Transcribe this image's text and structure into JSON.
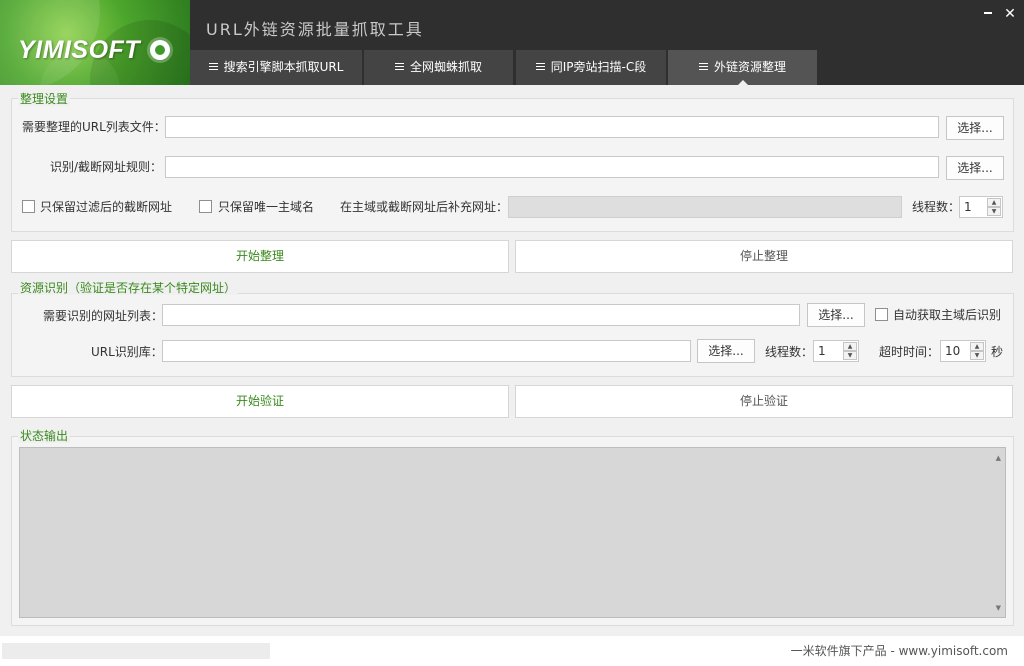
{
  "app": {
    "logo_text": "YIMISOFT",
    "title": "URL外链资源批量抓取工具"
  },
  "tabs": [
    {
      "label": "搜索引擎脚本抓取URL",
      "active": false
    },
    {
      "label": "全网蜘蛛抓取",
      "active": false
    },
    {
      "label": "同IP旁站扫描-C段",
      "active": false
    },
    {
      "label": "外链资源整理",
      "active": true
    }
  ],
  "organize": {
    "group_title": "整理设置",
    "url_list_label": "需要整理的URL列表文件：",
    "url_list_value": "",
    "rule_label": "识别/截断网址规则：",
    "rule_value": "",
    "select_label": "选择...",
    "keep_filtered_label": "只保留过滤后的截断网址",
    "keep_filtered_checked": false,
    "keep_unique_label": "只保留唯一主域名",
    "keep_unique_checked": false,
    "suffix_label": "在主域或截断网址后补充网址：",
    "suffix_value": "",
    "threads_label": "线程数：",
    "threads_value": "1",
    "start_label": "开始整理",
    "stop_label": "停止整理"
  },
  "identify": {
    "group_title": "资源识别（验证是否存在某个特定网址）",
    "list_label": "需要识别的网址列表：",
    "list_value": "",
    "select_label": "选择...",
    "auto_label": "自动获取主域后识别",
    "auto_checked": false,
    "lib_label": "URL识别库：",
    "lib_value": "",
    "threads_label": "线程数：",
    "threads_value": "1",
    "timeout_label": "超时时间：",
    "timeout_value": "10",
    "timeout_unit": "秒",
    "start_label": "开始验证",
    "stop_label": "停止验证"
  },
  "status": {
    "group_title": "状态输出",
    "output": ""
  },
  "footer": {
    "text": "一米软件旗下产品 - www.yimisoft.com"
  },
  "colors": {
    "accent_green": "#3a8a1e",
    "header_bg": "#2f2f2f",
    "tab_bg": "#444444",
    "tab_active_bg": "#545454"
  }
}
